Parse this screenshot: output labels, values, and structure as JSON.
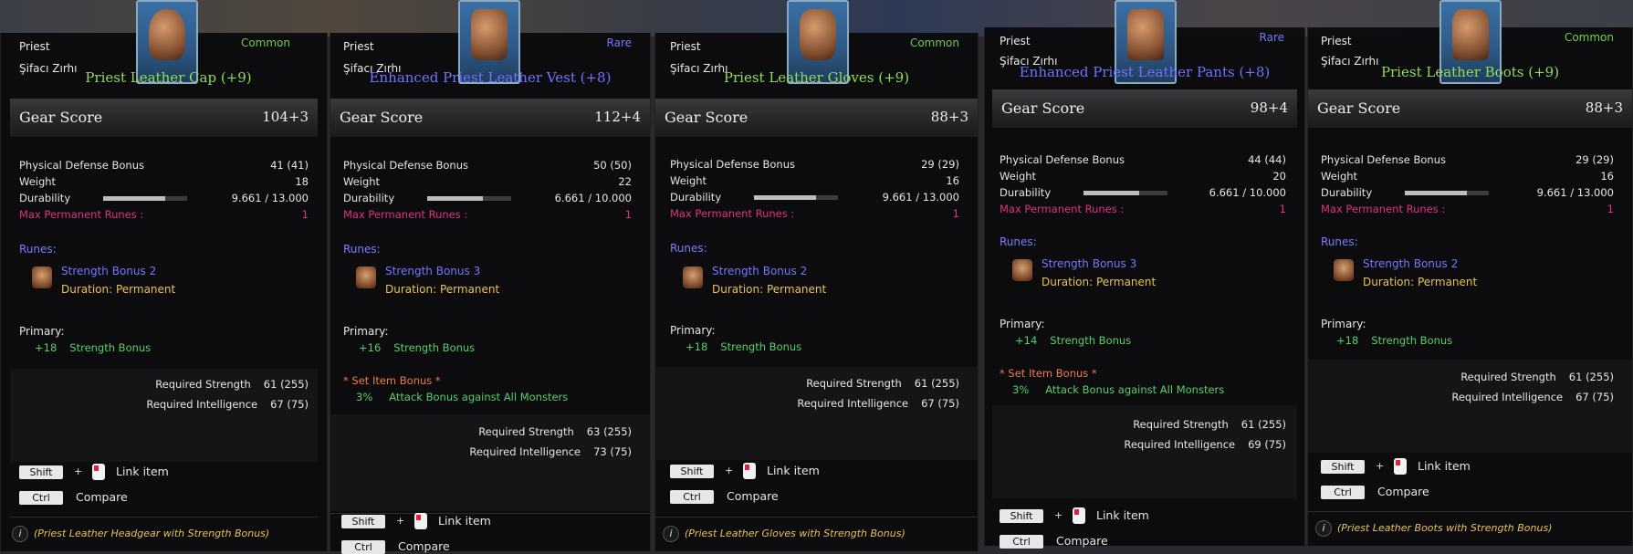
{
  "items": [
    {
      "cls": "Priest",
      "sub": "Şifacı Zırhı",
      "rarity": "Common",
      "name": "Priest Leather Cap (+9)",
      "gear_score_label": "Gear Score",
      "gear_score": "104+3",
      "stats": {
        "pdb_label": "Physical Defense Bonus",
        "pdb": "41 (41)",
        "weight_label": "Weight",
        "weight": "18",
        "dur_label": "Durability",
        "dur": "9.661 / 13.000",
        "dur_fraction": 0.743,
        "runes_max_label": "Max Permanent Runes :",
        "runes_max": "1"
      },
      "runes_label": "Runes:",
      "rune_name": "Strength Bonus 2",
      "rune_duration": "Duration: Permanent",
      "primary_label": "Primary:",
      "primary_val": "+18",
      "primary_stat": "Strength Bonus",
      "req_str_label": "Required Strength",
      "req_str": "61 (255)",
      "req_int_label": "Required Intelligence",
      "req_int": "67 (75)",
      "shift": "Shift",
      "plus": "+",
      "link": "Link item",
      "ctrl": "Ctrl",
      "compare": "Compare",
      "desc": "(Priest Leather Headgear with Strength Bonus)"
    },
    {
      "cls": "Priest",
      "sub": "Şifacı Zırhı",
      "rarity": "Rare",
      "name": "Enhanced Priest Leather Vest (+8)",
      "gear_score_label": "Gear Score",
      "gear_score": "112+4",
      "stats": {
        "pdb_label": "Physical Defense Bonus",
        "pdb": "50 (50)",
        "weight_label": "Weight",
        "weight": "22",
        "dur_label": "Durability",
        "dur": "6.661 / 10.000",
        "dur_fraction": 0.666,
        "runes_max_label": "Max Permanent Runes :",
        "runes_max": "1"
      },
      "runes_label": "Runes:",
      "rune_name": "Strength Bonus 3",
      "rune_duration": "Duration: Permanent",
      "primary_label": "Primary:",
      "primary_val": "+16",
      "primary_stat": "Strength Bonus",
      "set_label": "* Set Item  Bonus *",
      "set_val": "3%",
      "set_stat": "Attack Bonus against All Monsters",
      "req_str_label": "Required Strength",
      "req_str": "63 (255)",
      "req_int_label": "Required Intelligence",
      "req_int": "73 (75)",
      "shift": "Shift",
      "plus": "+",
      "link": "Link item",
      "ctrl": "Ctrl",
      "compare": "Compare"
    },
    {
      "cls": "Priest",
      "sub": "Şifacı Zırhı",
      "rarity": "Common",
      "name": "Priest Leather Gloves (+9)",
      "gear_score_label": "Gear Score",
      "gear_score": "88+3",
      "stats": {
        "pdb_label": "Physical Defense Bonus",
        "pdb": "29 (29)",
        "weight_label": "Weight",
        "weight": "16",
        "dur_label": "Durability",
        "dur": "9.661 / 13.000",
        "dur_fraction": 0.743,
        "runes_max_label": "Max Permanent Runes :",
        "runes_max": "1"
      },
      "runes_label": "Runes:",
      "rune_name": "Strength Bonus 2",
      "rune_duration": "Duration: Permanent",
      "primary_label": "Primary:",
      "primary_val": "+18",
      "primary_stat": "Strength Bonus",
      "req_str_label": "Required Strength",
      "req_str": "61 (255)",
      "req_int_label": "Required Intelligence",
      "req_int": "67 (75)",
      "shift": "Shift",
      "plus": "+",
      "link": "Link item",
      "ctrl": "Ctrl",
      "compare": "Compare",
      "desc": "(Priest Leather Gloves with Strength Bonus)"
    },
    {
      "cls": "Priest",
      "sub": "Şifacı Zırhı",
      "rarity": "Rare",
      "name": "Enhanced Priest Leather Pants (+8)",
      "gear_score_label": "Gear Score",
      "gear_score": "98+4",
      "stats": {
        "pdb_label": "Physical Defense Bonus",
        "pdb": "44 (44)",
        "weight_label": "Weight",
        "weight": "20",
        "dur_label": "Durability",
        "dur": "6.661 / 10.000",
        "dur_fraction": 0.666,
        "runes_max_label": "Max Permanent Runes :",
        "runes_max": "1"
      },
      "runes_label": "Runes:",
      "rune_name": "Strength Bonus 3",
      "rune_duration": "Duration: Permanent",
      "primary_label": "Primary:",
      "primary_val": "+14",
      "primary_stat": "Strength Bonus",
      "set_label": "* Set Item  Bonus *",
      "set_val": "3%",
      "set_stat": "Attack Bonus against All Monsters",
      "req_str_label": "Required Strength",
      "req_str": "61 (255)",
      "req_int_label": "Required Intelligence",
      "req_int": "69 (75)",
      "shift": "Shift",
      "plus": "+",
      "link": "Link item",
      "ctrl": "Ctrl",
      "compare": "Compare"
    },
    {
      "cls": "Priest",
      "sub": "Şifacı Zırhı",
      "rarity": "Common",
      "name": "Priest Leather Boots (+9)",
      "gear_score_label": "Gear Score",
      "gear_score": "88+3",
      "stats": {
        "pdb_label": "Physical Defense Bonus",
        "pdb": "29 (29)",
        "weight_label": "Weight",
        "weight": "16",
        "dur_label": "Durability",
        "dur": "9.661 / 13.000",
        "dur_fraction": 0.743,
        "runes_max_label": "Max Permanent Runes :",
        "runes_max": "1"
      },
      "runes_label": "Runes:",
      "rune_name": "Strength Bonus 2",
      "rune_duration": "Duration: Permanent",
      "primary_label": "Primary:",
      "primary_val": "+18",
      "primary_stat": "Strength Bonus",
      "req_str_label": "Required Strength",
      "req_str": "61 (255)",
      "req_int_label": "Required Intelligence",
      "req_int": "67 (75)",
      "shift": "Shift",
      "plus": "+",
      "link": "Link item",
      "ctrl": "Ctrl",
      "compare": "Compare",
      "desc": "(Priest Leather Boots with Strength Bonus)"
    }
  ],
  "colors": {
    "common": "#6fcf4b",
    "rare": "#6f7bff",
    "rune": "#7478ff",
    "set": "#f07a4a",
    "stat_green": "#58d06a",
    "max_runes": "#e0308a"
  }
}
